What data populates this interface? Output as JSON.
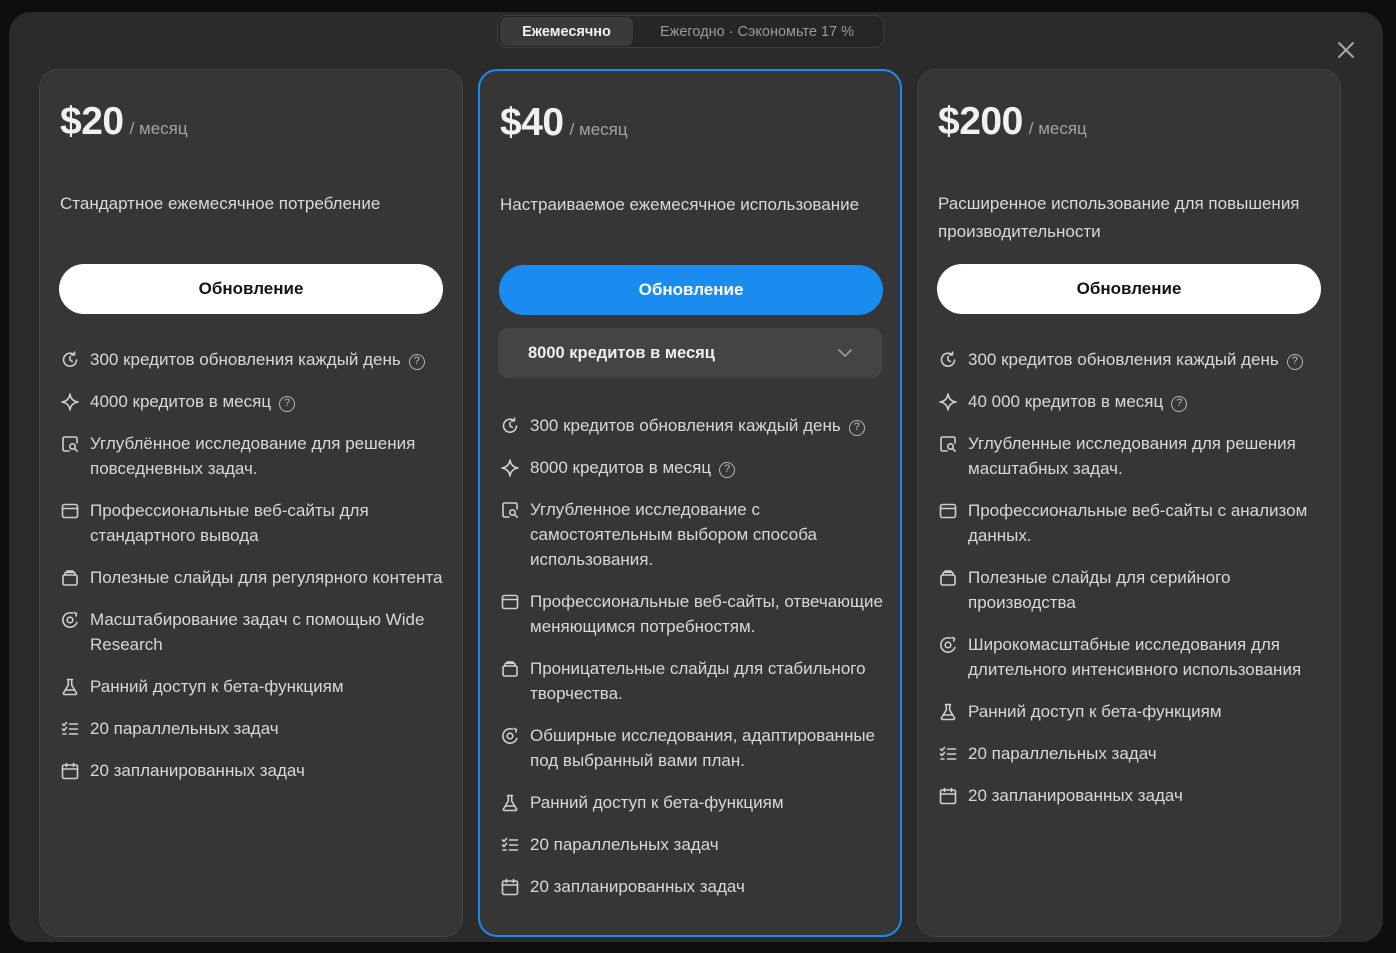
{
  "billing_toggle": {
    "monthly_label": "Ежемесячно",
    "yearly_label": "Ежегодно · Сэкономьте 17 %"
  },
  "plans": [
    {
      "price": "$20",
      "period": "/ месяц",
      "description": "Стандартное ежемесячное потребление",
      "button_label": "Обновление",
      "features": [
        {
          "icon": "refresh-clock-icon",
          "text": "300 кредитов обновления каждый день",
          "help": "?"
        },
        {
          "icon": "sparkle-icon",
          "text": "4000 кредитов в месяц",
          "help": "?"
        },
        {
          "icon": "search-document-icon",
          "text": "Углублённое исследование для решения повседневных задач."
        },
        {
          "icon": "browser-window-icon",
          "text": "Профессиональные веб-сайты для стандартного вывода"
        },
        {
          "icon": "slides-icon",
          "text": "Полезные слайды для регулярного контента"
        },
        {
          "icon": "wide-research-icon",
          "text": "Масштабирование задач с помощью Wide Research"
        },
        {
          "icon": "flask-icon",
          "text": "Ранний доступ к бета-функциям"
        },
        {
          "icon": "checklist-icon",
          "text": "20 параллельных задач"
        },
        {
          "icon": "calendar-icon",
          "text": "20 запланированных задач"
        }
      ]
    },
    {
      "price": "$40",
      "period": "/ месяц",
      "description": "Настраиваемое ежемесячное использование",
      "button_label": "Обновление",
      "credits_select": "8000 кредитов в месяц",
      "features": [
        {
          "icon": "refresh-clock-icon",
          "text": "300 кредитов обновления каждый день",
          "help": "?"
        },
        {
          "icon": "sparkle-icon",
          "text": "8000 кредитов в месяц",
          "help": "?"
        },
        {
          "icon": "search-document-icon",
          "text": "Углубленное исследование с самостоятельным выбором способа использования."
        },
        {
          "icon": "browser-window-icon",
          "text": "Профессиональные веб-сайты, отвечающие меняющимся потребностям."
        },
        {
          "icon": "slides-icon",
          "text": "Проницательные слайды для стабильного творчества."
        },
        {
          "icon": "wide-research-icon",
          "text": "Обширные исследования, адаптированные под выбранный вами план."
        },
        {
          "icon": "flask-icon",
          "text": "Ранний доступ к бета-функциям"
        },
        {
          "icon": "checklist-icon",
          "text": "20 параллельных задач"
        },
        {
          "icon": "calendar-icon",
          "text": "20 запланированных задач"
        }
      ]
    },
    {
      "price": "$200",
      "period": "/ месяц",
      "description": "Расширенное использование для повышения производительности",
      "button_label": "Обновление",
      "features": [
        {
          "icon": "refresh-clock-icon",
          "text": "300 кредитов обновления каждый день",
          "help": "?"
        },
        {
          "icon": "sparkle-icon",
          "text": "40 000 кредитов в месяц",
          "help": "?"
        },
        {
          "icon": "search-document-icon",
          "text": "Углубленные исследования для решения масштабных задач."
        },
        {
          "icon": "browser-window-icon",
          "text": "Профессиональные веб-сайты с анализом данных."
        },
        {
          "icon": "slides-icon",
          "text": "Полезные слайды для серийного производства"
        },
        {
          "icon": "wide-research-icon",
          "text": "Широкомасштабные исследования для длительного интенсивного использования"
        },
        {
          "icon": "flask-icon",
          "text": "Ранний доступ к бета-функциям"
        },
        {
          "icon": "checklist-icon",
          "text": "20 параллельных задач"
        },
        {
          "icon": "calendar-icon",
          "text": "20 запланированных задач"
        }
      ]
    }
  ],
  "colors": {
    "accent": "#1a8cf0",
    "modal_bg": "#2b2b2c",
    "card_bg": "#363637"
  }
}
